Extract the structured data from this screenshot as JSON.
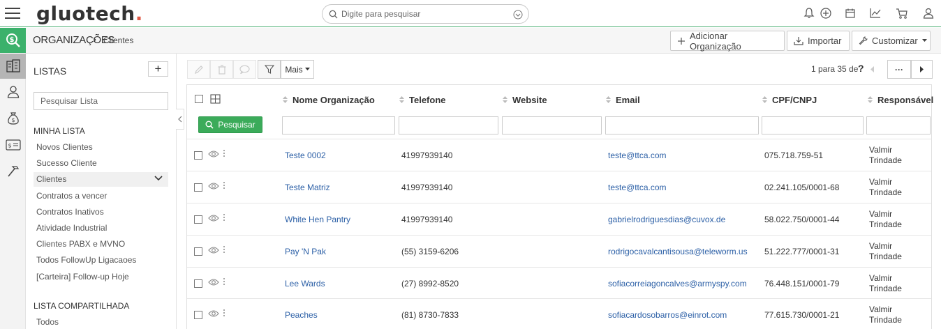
{
  "app": {
    "logo_main": "gluo",
    "logo_accent": "tech",
    "logo_dot": ".",
    "search_placeholder": "Digite para pesquisar"
  },
  "breadcrumb": {
    "root": "ORGANIZAÇÕES",
    "separator": "›",
    "leaf": "Clientes"
  },
  "header_actions": {
    "add": "Adicionar Organização",
    "import": "Importar",
    "customize": "Customizar"
  },
  "sidebar": {
    "title": "LISTAS",
    "add": "+",
    "search_placeholder": "Pesquisar Lista",
    "my_list_title": "MINHA LISTA",
    "my_list": [
      "Novos Clientes",
      "Sucesso Cliente",
      "Clientes",
      "Contratos a vencer",
      "Contratos Inativos",
      "Atividade Industrial",
      "Clientes PABX e MVNO",
      "Todos FollowUp Ligacaoes",
      "[Carteira] Follow-up Hoje"
    ],
    "selected": "Clientes",
    "shared_title": "LISTA COMPARTILHADA",
    "shared_list": [
      "Todos"
    ]
  },
  "toolbar": {
    "more": "Mais",
    "pager": "1 para 35  de",
    "pager_help": "?",
    "pager_more": "···"
  },
  "table": {
    "columns": {
      "name": "Nome Organização",
      "phone": "Telefone",
      "website": "Website",
      "email": "Email",
      "doc": "CPF/CNPJ",
      "owner": "Responsável"
    },
    "search_button": "Pesquisar",
    "rows": [
      {
        "name": "Teste 0002",
        "phone": "41997939140",
        "website": "",
        "email": "teste@ttca.com",
        "doc": "075.718.759-51",
        "owner_first": "Valmir",
        "owner_last": "Trindade"
      },
      {
        "name": "Teste Matriz",
        "phone": "41997939140",
        "website": "",
        "email": "teste@ttca.com",
        "doc": "02.241.105/0001-68",
        "owner_first": "Valmir",
        "owner_last": "Trindade"
      },
      {
        "name": "White Hen Pantry",
        "phone": "41997939140",
        "website": "",
        "email": "gabrielrodriguesdias@cuvox.de",
        "doc": "58.022.750/0001-44",
        "owner_first": "Valmir",
        "owner_last": "Trindade"
      },
      {
        "name": "Pay 'N Pak",
        "phone": "(55) 3159-6206",
        "website": "",
        "email": "rodrigocavalcantisousa@teleworm.us",
        "doc": "51.222.777/0001-31",
        "owner_first": "Valmir",
        "owner_last": "Trindade"
      },
      {
        "name": "Lee Wards",
        "phone": "(27) 8992-8520",
        "website": "",
        "email": "sofiacorreiagoncalves@armyspy.com",
        "doc": "76.448.151/0001-79",
        "owner_first": "Valmir",
        "owner_last": "Trindade"
      },
      {
        "name": "Peaches",
        "phone": "(81) 8730-7833",
        "website": "",
        "email": "sofiacardosobarros@einrot.com",
        "doc": "77.615.730/0001-21",
        "owner_first": "Valmir",
        "owner_last": "Trindade"
      }
    ]
  },
  "colors": {
    "accent_green": "#3bb16b",
    "link_blue": "#2b5fa6",
    "logo_dot": "#e05a47"
  }
}
